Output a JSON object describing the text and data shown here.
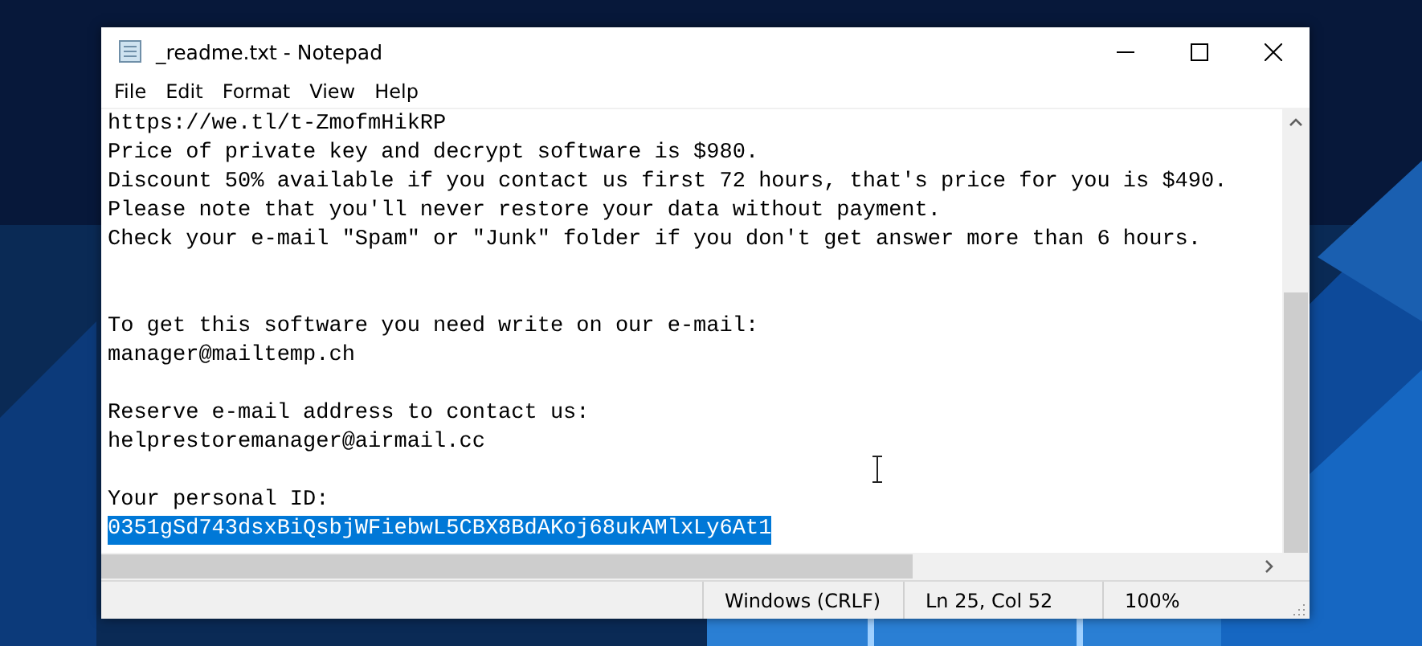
{
  "window": {
    "title": "_readme.txt - Notepad"
  },
  "menu": [
    "File",
    "Edit",
    "Format",
    "View",
    "Help"
  ],
  "lines": [
    {
      "kind": "text",
      "text": "https://we.tl/t-ZmofmHikRP",
      "selected": false
    },
    {
      "kind": "text",
      "text": "Price of private key and decrypt software is $980.",
      "selected": false
    },
    {
      "kind": "text",
      "text": "Discount 50% available if you contact us first 72 hours, that's price for you is $490.",
      "selected": false
    },
    {
      "kind": "text",
      "text": "Please note that you'll never restore your data without payment.",
      "selected": false
    },
    {
      "kind": "text",
      "text": "Check your e-mail \"Spam\" or \"Junk\" folder if you don't get answer more than 6 hours.",
      "selected": false
    },
    {
      "kind": "blank"
    },
    {
      "kind": "blank"
    },
    {
      "kind": "text",
      "text": "To get this software you need write on our e-mail:",
      "selected": false
    },
    {
      "kind": "text",
      "text": "manager@mailtemp.ch",
      "selected": false
    },
    {
      "kind": "blank"
    },
    {
      "kind": "text",
      "text": "Reserve e-mail address to contact us:",
      "selected": false
    },
    {
      "kind": "text",
      "text": "helprestoremanager@airmail.cc",
      "selected": false
    },
    {
      "kind": "blank"
    },
    {
      "kind": "text",
      "text": "Your personal ID:",
      "selected": false
    },
    {
      "kind": "text",
      "text": "0351gSd743dsxBiQsbjWFiebwL5CBX8BdAKoj68ukAMlxLy6At1",
      "selected": true
    }
  ],
  "status_bar": [
    "Windows (CRLF)",
    "Ln 25, Col 52",
    "100%"
  ]
}
